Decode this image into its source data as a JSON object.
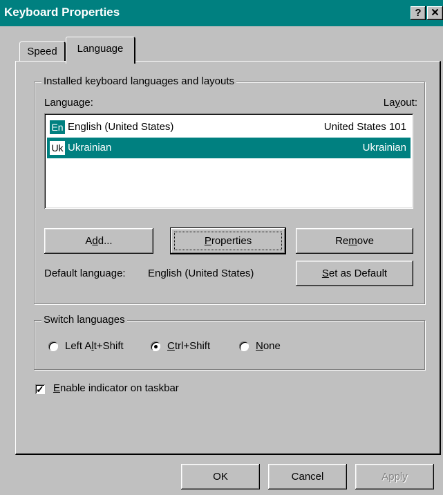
{
  "window": {
    "title": "Keyboard Properties",
    "help_label": "?",
    "close_label": "✕"
  },
  "tabs": [
    {
      "label": "Speed"
    },
    {
      "label": "Language"
    }
  ],
  "installed_group": {
    "label": "Installed keyboard languages and layouts",
    "col_language": "Language:",
    "col_layout": "Layout:",
    "items": [
      {
        "code": "En",
        "language": "English (United States)",
        "layout": "United States 101"
      },
      {
        "code": "Uk",
        "language": "Ukrainian",
        "layout": "Ukrainian"
      }
    ],
    "selected_index": 1,
    "buttons": {
      "add": "Add...",
      "properties": "Properties",
      "remove": "Remove",
      "set_default": "Set as Default"
    },
    "default_label": "Default language:",
    "default_value": "English (United States)"
  },
  "switch_group": {
    "label": "Switch languages",
    "options": [
      {
        "label": "Left Alt+Shift",
        "checked": false
      },
      {
        "label": "Ctrl+Shift",
        "checked": true
      },
      {
        "label": "None",
        "checked": false
      }
    ]
  },
  "indicator": {
    "label": "Enable indicator on taskbar",
    "checked": true
  },
  "footer": {
    "ok": "OK",
    "cancel": "Cancel",
    "apply": "Apply"
  },
  "colors": {
    "titlebar": "#008080",
    "face": "#c0c0c0",
    "selection": "#008080"
  }
}
